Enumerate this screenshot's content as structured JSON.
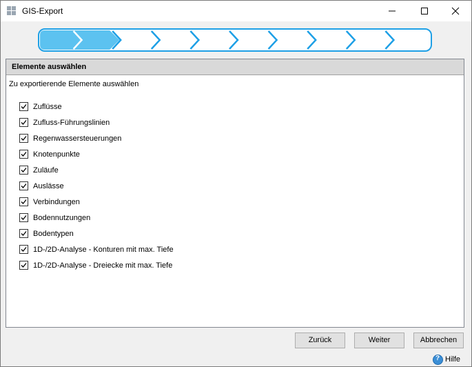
{
  "window": {
    "title": "GIS-Export",
    "app_icon": "grid-app-icon"
  },
  "wizard": {
    "total_steps": 10,
    "current_step": 2
  },
  "section": {
    "title": "Elemente auswählen",
    "subtitle": "Zu exportierende Elemente auswählen"
  },
  "items": [
    {
      "label": "Zuflüsse",
      "checked": true
    },
    {
      "label": "Zufluss-Führungslinien",
      "checked": true
    },
    {
      "label": "Regenwassersteuerungen",
      "checked": true
    },
    {
      "label": "Knotenpunkte",
      "checked": true
    },
    {
      "label": "Zuläufe",
      "checked": true
    },
    {
      "label": "Auslässe",
      "checked": true
    },
    {
      "label": "Verbindungen",
      "checked": true
    },
    {
      "label": "Bodennutzungen",
      "checked": true
    },
    {
      "label": "Bodentypen",
      "checked": true
    },
    {
      "label": "1D-/2D-Analyse - Konturen mit max. Tiefe",
      "checked": true
    },
    {
      "label": "1D-/2D-Analyse - Dreiecke mit max. Tiefe",
      "checked": true
    }
  ],
  "buttons": {
    "back": "Zurück",
    "next": "Weiter",
    "cancel": "Abbrechen",
    "help": "Hilfe"
  },
  "colors": {
    "step_border": "#1ea0e6",
    "step_active": "#5cc2f0",
    "step_inactive": "#ffffff",
    "help_icon": "#3c8fd6"
  }
}
